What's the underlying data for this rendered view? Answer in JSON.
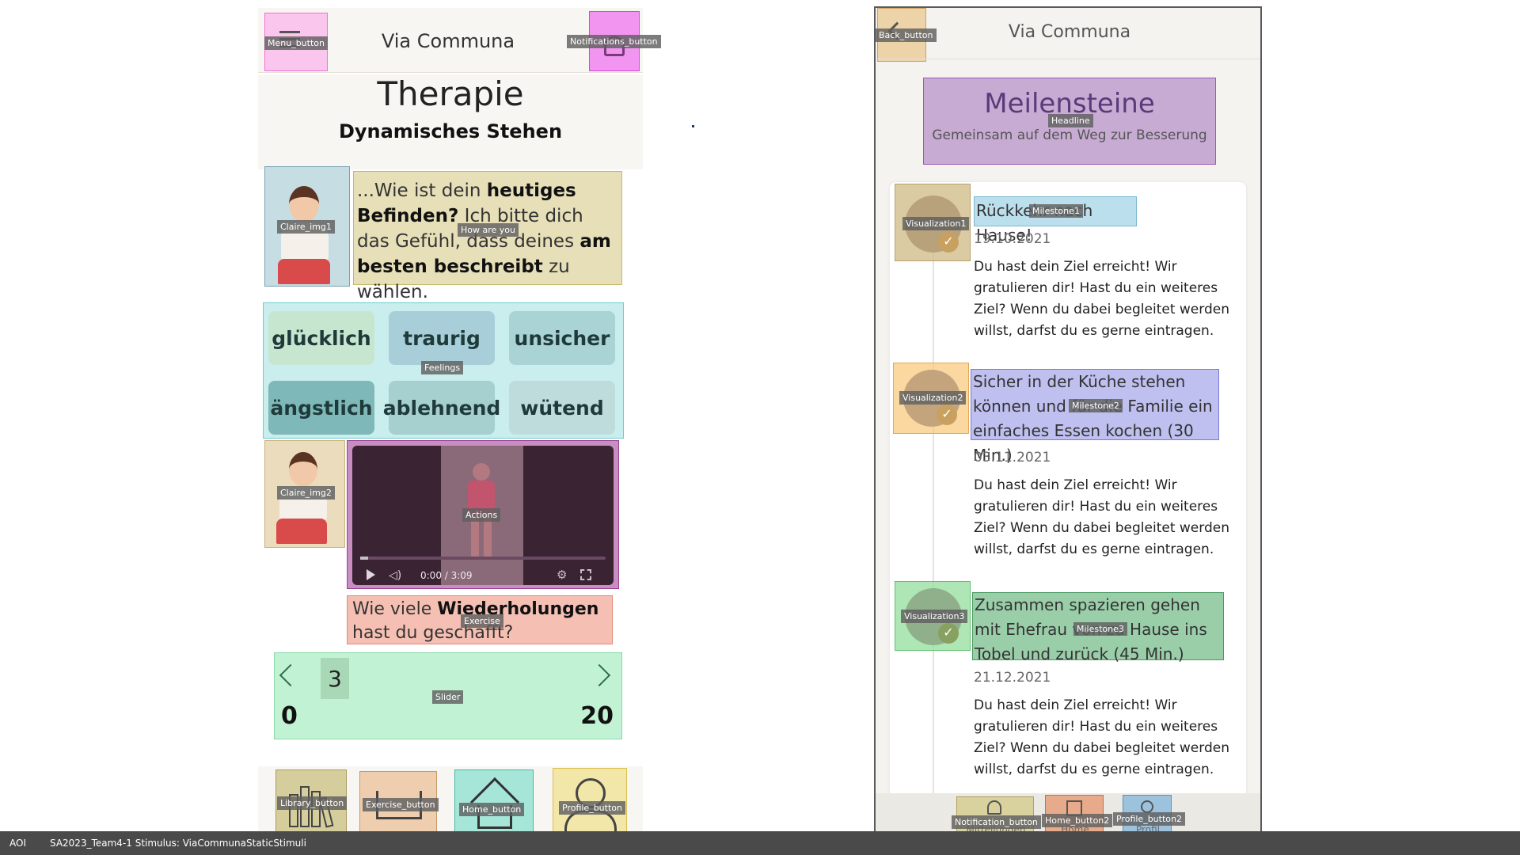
{
  "left": {
    "app_title": "Via Communa",
    "page_title": "Therapie",
    "subtitle": "Dynamisches Stehen",
    "prompt_pre": "...Wie ist dein ",
    "prompt_bold1": "heutiges Befinden?",
    "prompt_mid": " Ich bitte dich  das Gefühl, dass deines ",
    "prompt_bold2": "am besten beschreibt",
    "prompt_post": " zu wählen.",
    "feelings": [
      "glücklich",
      "traurig",
      "unsicher",
      "ängstlich",
      "ablehnend",
      "wütend"
    ],
    "video_time": "0:00 / 3:09",
    "exercise_pre": "Wie viele ",
    "exercise_bold": "Wiederholungen",
    "exercise_post": " hast du geschafft?",
    "slider_value": "3",
    "slider_min": "0",
    "slider_max": "20",
    "slider_level": 3
  },
  "right": {
    "app_title": "Via Communa",
    "headline": "Meilensteine",
    "headline_sub": "Gemeinsam auf dem Weg zur Besserung",
    "milestones": [
      {
        "title": "Rückkehr nach Hause!",
        "date": "19.10.2021",
        "body": "Du hast dein Ziel erreicht! Wir gratulieren dir! Hast du ein weiteres Ziel? Wenn du dabei begleitet werden willst, darfst du es gerne eintragen."
      },
      {
        "title": "Sicher in der Küche stehen können und für die Familie ein einfaches Essen kochen (30 Min.)",
        "date": "03.11.2021",
        "body": "Du hast dein Ziel erreicht! Wir gratulieren dir! Hast du ein weiteres Ziel? Wenn du dabei begleitet werden willst, darfst du es gerne eintragen."
      },
      {
        "title": "Zusammen spazieren gehen mit Ehefrau von zu Hause ins Tobel und zurück (45 Min.)",
        "date": "21.12.2021",
        "body": "Du hast dein Ziel erreicht! Wir gratulieren dir! Hast du ein weiteres Ziel? Wenn du dabei begleitet werden willst, darfst du es gerne eintragen."
      }
    ],
    "nav_labels": [
      "Mitteilungen",
      "Home",
      "Profil"
    ]
  },
  "aoi_labels": {
    "menu": "Menu_button",
    "notifications": "Notifications_button",
    "claire1": "Claire_img1",
    "how_are_you": "How are you",
    "feelings": "Feelings",
    "claire2": "Claire_img2",
    "actions": "Actions",
    "exercise": "Exercise",
    "slider": "Slider",
    "library": "Library_button",
    "exercise_button": "Exercise_button",
    "home": "Home_button",
    "profile": "Profile_button",
    "back": "Back_button",
    "headline": "Headline",
    "vis1": "Visualization1",
    "ms1": "Milestone1",
    "vis2": "Visualization2",
    "ms2": "Milestone2",
    "vis3": "Visualization3",
    "ms3": "Milestone3",
    "notification_button": "Notification_button",
    "home2": "Home_button2",
    "profile2": "Profile_button2"
  },
  "footer": {
    "aoi": "AOI",
    "info": "SA2023_Team4-1  Stimulus: ViaCommunaStaticStimuli"
  },
  "colors": {
    "menu_aoi": "#ff8ce6",
    "notif_aoi": "#ee55ee",
    "claire_aoi": "#8fb8c4",
    "howareyou_aoi": "#dcd29a",
    "feelings_aoi": "#9edfe0",
    "actions_aoi": "#b05ea8",
    "exercise_aoi": "#f2b0a0",
    "slider_aoi": "#b7f0cc"
  }
}
